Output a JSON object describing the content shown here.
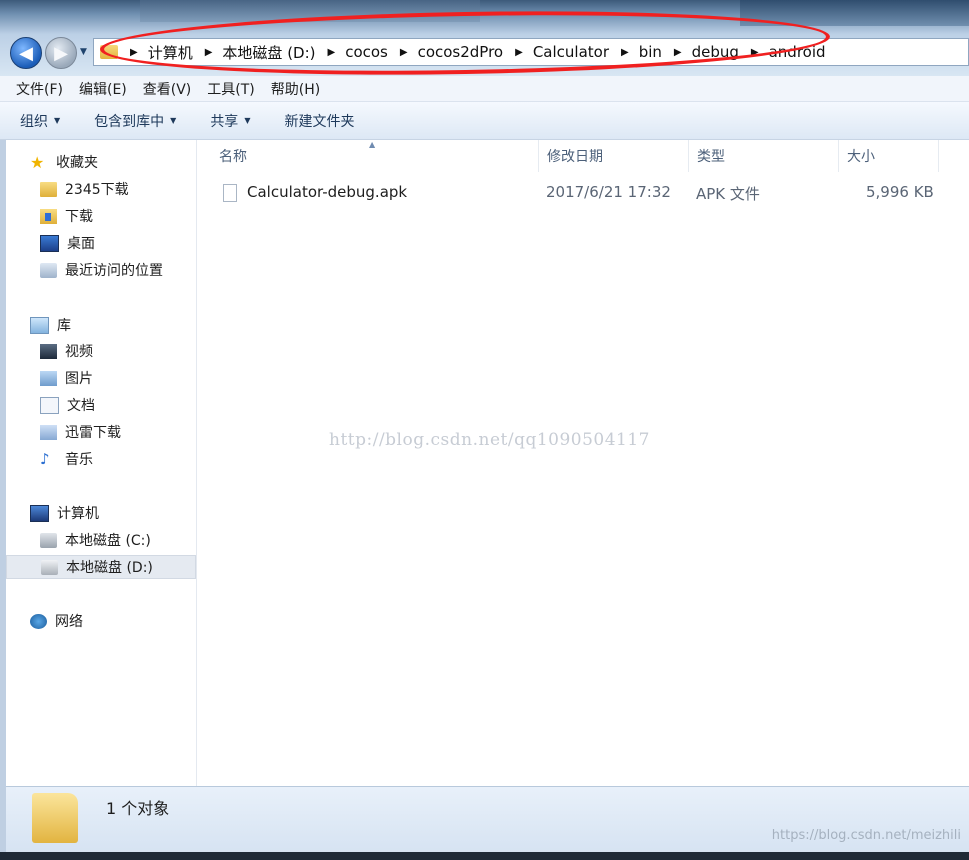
{
  "breadcrumb": [
    "计算机",
    "本地磁盘 (D:)",
    "cocos",
    "cocos2dPro",
    "Calculator",
    "bin",
    "debug",
    "android"
  ],
  "menu": [
    "文件(F)",
    "编辑(E)",
    "查看(V)",
    "工具(T)",
    "帮助(H)"
  ],
  "toolbar": {
    "organize": "组织",
    "include_library": "包含到库中",
    "share": "共享",
    "new_folder": "新建文件夹"
  },
  "nav": {
    "favorites": "收藏夹",
    "fav_2345": "2345下载",
    "fav_downloads": "下载",
    "fav_desktop": "桌面",
    "fav_recent": "最近访问的位置",
    "libraries": "库",
    "lib_video": "视频",
    "lib_pictures": "图片",
    "lib_docs": "文档",
    "lib_thunder": "迅雷下载",
    "lib_music": "音乐",
    "computer": "计算机",
    "drive_c": "本地磁盘 (C:)",
    "drive_d": "本地磁盘 (D:)",
    "network": "网络"
  },
  "columns": {
    "name": "名称",
    "modified": "修改日期",
    "type": "类型",
    "size": "大小"
  },
  "file": {
    "name": "Calculator-debug.apk",
    "modified": "2017/6/21 17:32",
    "type": "APK 文件",
    "size": "5,996 KB"
  },
  "status": {
    "count": "1 个对象"
  },
  "watermark_center": "http://blog.csdn.net/qq1090504117",
  "watermark_corner": "https://blog.csdn.net/meizhili"
}
